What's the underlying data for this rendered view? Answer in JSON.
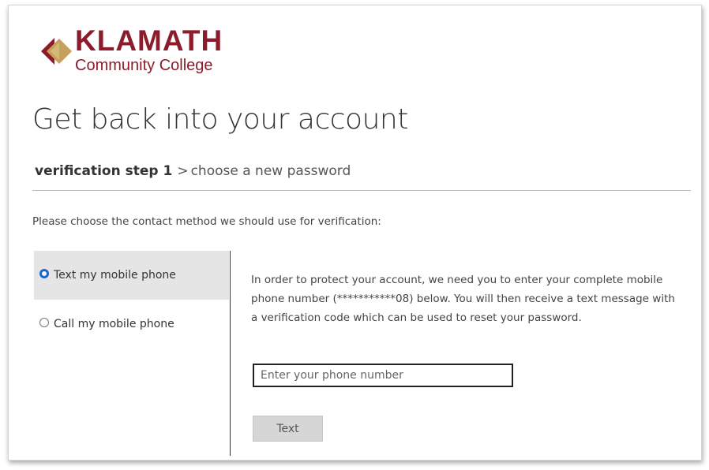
{
  "brand": {
    "name_line1": "KLAMATH",
    "name_line2": "Community College",
    "primary_color": "#8c1c2c",
    "accent_color": "#c6a15b"
  },
  "page": {
    "title": "Get back into your account"
  },
  "steps": {
    "current": "verification step 1",
    "separator": ">",
    "next": "choose a new password"
  },
  "prompt": "Please choose the contact method we should use for verification:",
  "methods": [
    {
      "label": "Text my mobile phone",
      "selected": true
    },
    {
      "label": "Call my mobile phone",
      "selected": false
    }
  ],
  "info_text": "In order to protect your account, we need you to enter your complete mobile phone number (***********08) below. You will then receive a text message with a verification code which can be used to reset your password.",
  "phone_input": {
    "value": "",
    "placeholder": "Enter your phone number"
  },
  "text_button_label": "Text",
  "icons": {
    "logo": "klamath-diamond-logo",
    "radio_on": "radio-selected-icon",
    "radio_off": "radio-unselected-icon"
  }
}
